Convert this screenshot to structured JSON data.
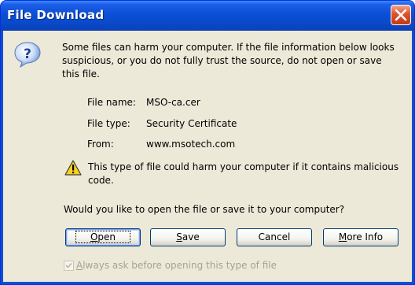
{
  "window": {
    "title": "File Download"
  },
  "message": "Some files can harm your computer. If the file information below looks suspicious, or you do not fully trust the source, do not open or save this file.",
  "file_info": {
    "name_label": "File name:",
    "name_value": "MSO-ca.cer",
    "type_label": "File type:",
    "type_value": "Security Certificate",
    "from_label": "From:",
    "from_value": "www.msotech.com"
  },
  "warning": "This type of file could harm your computer if it contains malicious code.",
  "question": "Would you like to open the file or save it to your computer?",
  "buttons": {
    "open": {
      "pre": "",
      "key": "O",
      "post": "pen"
    },
    "save": {
      "pre": "",
      "key": "S",
      "post": "ave"
    },
    "cancel": {
      "label": "Cancel"
    },
    "more_info": {
      "pre": "",
      "key": "M",
      "post": "ore Info"
    }
  },
  "checkbox": {
    "checked": true,
    "pre": "",
    "key": "A",
    "post": "lways ask before opening this type of file"
  },
  "icons": {
    "title_close": "close-icon",
    "info": "question-icon",
    "warning": "warning-icon",
    "check": "checkmark-icon"
  },
  "colors": {
    "titlebar": "#0a4fd6",
    "client": "#ece9d8",
    "close": "#e0512a",
    "disabled_text": "#a6a392"
  }
}
